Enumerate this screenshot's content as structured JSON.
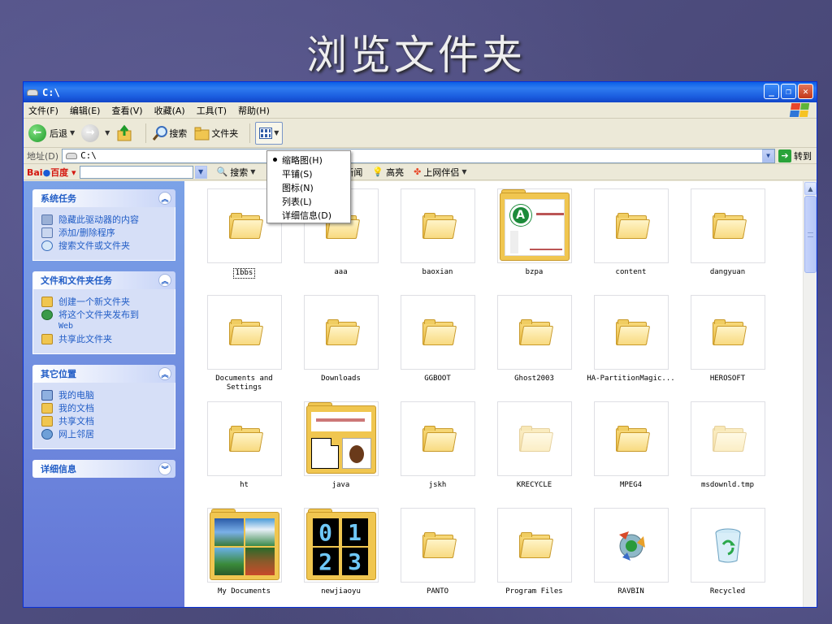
{
  "slide_title": "浏览文件夹",
  "window": {
    "title": "C:\\",
    "menu": [
      "文件(F)",
      "编辑(E)",
      "查看(V)",
      "收藏(A)",
      "工具(T)",
      "帮助(H)"
    ],
    "controls": {
      "minimize": "_",
      "restore": "❐",
      "close": "✕"
    }
  },
  "toolbar": {
    "back_label": "后退",
    "search_label": "搜索",
    "folders_label": "文件夹"
  },
  "address": {
    "label": "地址(D)",
    "value": "C:\\",
    "go_label": "转到"
  },
  "baidu": {
    "logo_a": "Bai",
    "logo_b": "百度",
    "search_label": "搜索",
    "news_label": "新闻",
    "highlight_label": "高亮",
    "partner_label": "上网伴侣"
  },
  "view_menu": {
    "items": [
      "缩略图(H)",
      "平铺(S)",
      "图标(N)",
      "列表(L)",
      "详细信息(D)"
    ],
    "selected_index": 0
  },
  "left_pane": {
    "system_tasks": {
      "title": "系统任务",
      "items": [
        "隐藏此驱动器的内容",
        "添加/删除程序",
        "搜索文件或文件夹"
      ]
    },
    "file_tasks": {
      "title": "文件和文件夹任务",
      "items": [
        "创建一个新文件夹",
        "将这个文件夹发布到",
        "Web",
        "共享此文件夹"
      ]
    },
    "other_places": {
      "title": "其它位置",
      "items": [
        "我的电脑",
        "我的文档",
        "共享文档",
        "网上邻居"
      ]
    },
    "details": {
      "title": "详细信息"
    }
  },
  "files": [
    {
      "name": "1bbs",
      "kind": "folder",
      "selected": true
    },
    {
      "name": "aaa",
      "kind": "folder"
    },
    {
      "name": "baoxian",
      "kind": "folder"
    },
    {
      "name": "bzpa",
      "kind": "folder-preview-logo"
    },
    {
      "name": "content",
      "kind": "folder"
    },
    {
      "name": "dangyuan",
      "kind": "folder"
    },
    {
      "name": "Documents and Settings",
      "kind": "folder"
    },
    {
      "name": "Downloads",
      "kind": "folder"
    },
    {
      "name": "GGBOOT",
      "kind": "folder"
    },
    {
      "name": "Ghost2003",
      "kind": "folder"
    },
    {
      "name": "HA-PartitionMagic...",
      "kind": "folder"
    },
    {
      "name": "HEROSOFT",
      "kind": "folder"
    },
    {
      "name": "ht",
      "kind": "folder"
    },
    {
      "name": "java",
      "kind": "folder-preview-java"
    },
    {
      "name": "jskh",
      "kind": "folder"
    },
    {
      "name": "KRECYCLE",
      "kind": "folder-ghost"
    },
    {
      "name": "MPEG4",
      "kind": "folder"
    },
    {
      "name": "msdownld.tmp",
      "kind": "folder-ghost"
    },
    {
      "name": "My Documents",
      "kind": "folder-preview-photos"
    },
    {
      "name": "newjiaoyu",
      "kind": "folder-preview-digits",
      "digits": [
        "0",
        "1",
        "2",
        "3"
      ]
    },
    {
      "name": "PANTO",
      "kind": "folder"
    },
    {
      "name": "Program Files",
      "kind": "folder"
    },
    {
      "name": "RAVBIN",
      "kind": "ravbin"
    },
    {
      "name": "Recycled",
      "kind": "recycle"
    }
  ]
}
